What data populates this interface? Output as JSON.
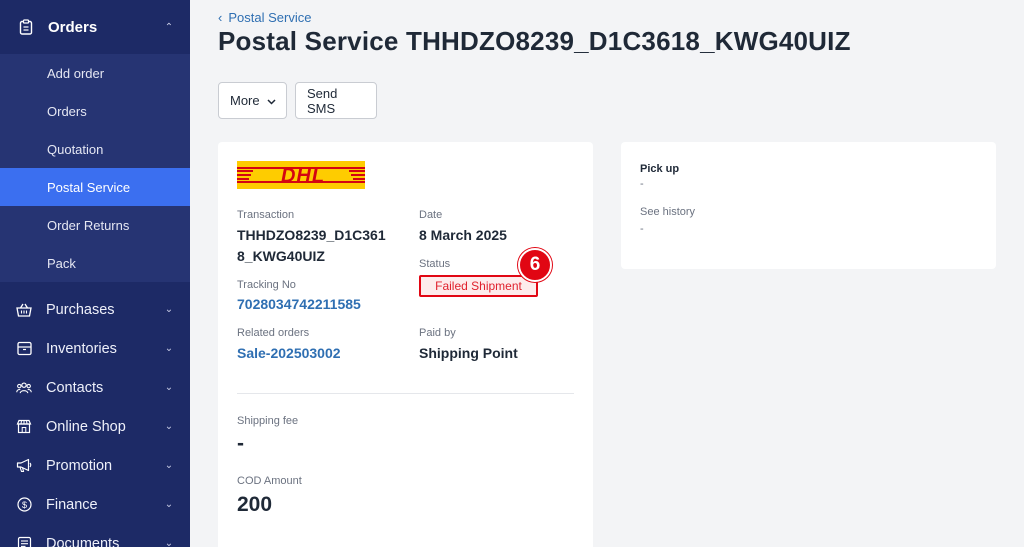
{
  "sidebar": {
    "top": {
      "label": "Orders",
      "icon": "clipboard-icon"
    },
    "subitems": [
      {
        "label": "Add order"
      },
      {
        "label": "Orders"
      },
      {
        "label": "Quotation"
      },
      {
        "label": "Postal Service",
        "active": true
      },
      {
        "label": "Order Returns"
      },
      {
        "label": "Pack"
      }
    ],
    "items": [
      {
        "label": "Purchases",
        "icon": "basket-icon"
      },
      {
        "label": "Inventories",
        "icon": "box-icon"
      },
      {
        "label": "Contacts",
        "icon": "people-icon"
      },
      {
        "label": "Online Shop",
        "icon": "shop-icon"
      },
      {
        "label": "Promotion",
        "icon": "megaphone-icon"
      },
      {
        "label": "Finance",
        "icon": "dollar-icon"
      },
      {
        "label": "Documents",
        "icon": "document-icon"
      }
    ]
  },
  "header": {
    "breadcrumb": "Postal Service",
    "title": "Postal Service THHDZO8239_D1C3618_KWG40UIZ"
  },
  "toolbar": {
    "more_label": "More",
    "sms_label": "Send SMS"
  },
  "shipment": {
    "carrier_logo_text": "DHL",
    "transaction_label": "Transaction",
    "transaction_line1": "THHDZO8239_D1C361",
    "transaction_line2": "8_KWG40UIZ",
    "date_label": "Date",
    "date_value": "8 March 2025",
    "status_label": "Status",
    "status_value": "Failed Shipment",
    "step_marker": "6",
    "tracking_label": "Tracking No",
    "tracking_value": "7028034742211585",
    "related_label": "Related orders",
    "related_value": "Sale-202503002",
    "paidby_label": "Paid by",
    "paidby_value": "Shipping Point",
    "fee_label": "Shipping fee",
    "fee_value": "-",
    "cod_label": "COD Amount",
    "cod_value": "200"
  },
  "pickup": {
    "pickup_label": "Pick up",
    "pickup_value": "-",
    "history_label": "See history",
    "history_value": "-"
  },
  "colors": {
    "sidebar_bg": "#1d2a66",
    "active_bg": "#3b6ff0",
    "link": "#2f6fb2",
    "status_red": "#e10613",
    "dhl_yellow": "#fecc00",
    "dhl_red": "#d40511"
  }
}
